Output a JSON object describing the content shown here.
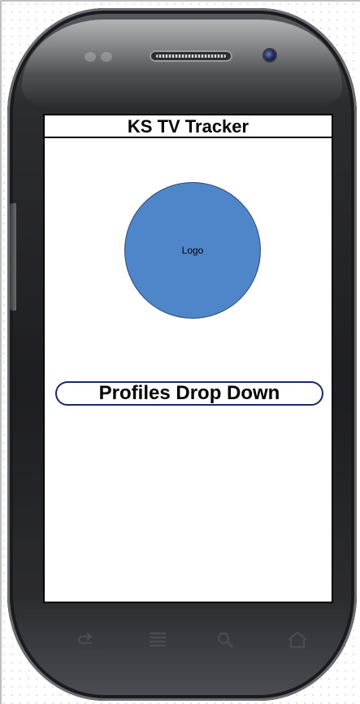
{
  "app": {
    "title": "KS TV Tracker"
  },
  "main": {
    "logo_label": "Logo",
    "profiles_dropdown_label": "Profiles Drop Down"
  },
  "device": {
    "nav_keys": [
      "back-icon",
      "menu-icon",
      "search-icon",
      "home-icon"
    ]
  },
  "colors": {
    "logo_fill": "#4f86c9",
    "phone_body": "#1d1e21",
    "screen_bg": "#ffffff"
  }
}
